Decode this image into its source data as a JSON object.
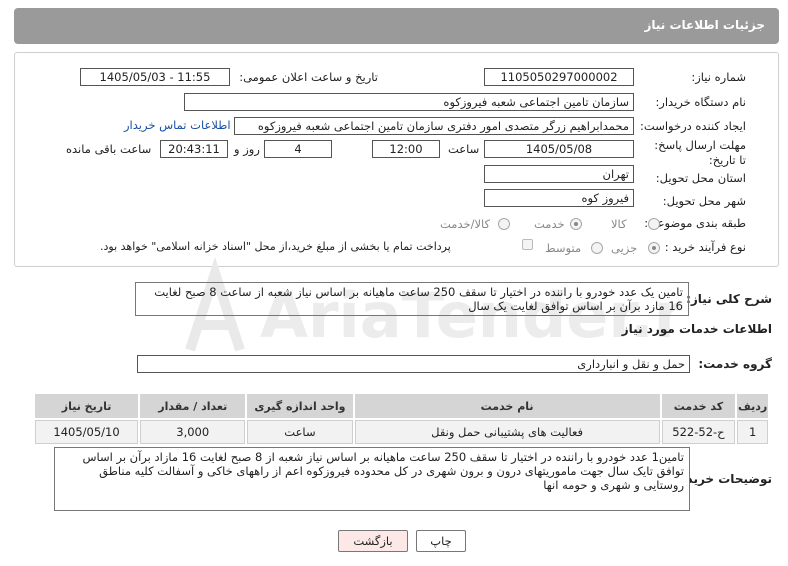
{
  "header": {
    "title": "جزئیات اطلاعات نیاز"
  },
  "form": {
    "need_number_label": "شماره نیاز:",
    "need_number": "1105050297000002",
    "announce_label": "تاریخ و ساعت اعلان عمومی:",
    "announce_value": "1405/05/03 - 11:55",
    "buyer_org_label": "نام دستگاه خریدار:",
    "buyer_org": "سازمان تامین اجتماعی شعبه فیروزکوه",
    "creator_label": "ایجاد کننده درخواست:",
    "creator": "محمدابراهیم زرگر متصدی امور دفتری سازمان تامین اجتماعی شعبه فیروزکوه",
    "contact_link": "اطلاعات تماس خریدار",
    "deadline_label": "مهلت ارسال پاسخ: تا تاریخ:",
    "deadline_date": "1405/05/08",
    "time_label": "ساعت",
    "deadline_time": "12:00",
    "days_value": "4",
    "days_label": "روز و",
    "remaining_time": "20:43:11",
    "remaining_label": "ساعت باقی مانده",
    "province_label": "استان محل تحویل:",
    "province": "تهران",
    "city_label": "شهر محل تحویل:",
    "city": "فیروز کوه",
    "category_label": "طبقه بندی موضوعی:",
    "category_options": [
      "کالا",
      "خدمت",
      "کالا/خدمت"
    ],
    "category_selected": "خدمت",
    "process_label": "نوع فرآیند خرید :",
    "process_options": [
      "جزیی",
      "متوسط"
    ],
    "process_note": "پرداخت تمام یا بخشی از مبلغ خرید،از محل \"اسناد خزانه اسلامی\" خواهد بود."
  },
  "description": {
    "label": "شرح کلی نیاز:",
    "text": "تامین یک عدد خودرو با راننده در اختیار تا سقف 250 ساعت ماهیانه بر اساس نیاز شعبه از ساعت 8 صبح لغایت 16 مازد برآن بر اساس توافق لغایت یک سال"
  },
  "services": {
    "section_title": "اطلاعات خدمات مورد نیاز",
    "group_label": "گروه خدمت:",
    "group_value": "حمل و نقل و انبارداری",
    "columns": [
      "ردیف",
      "کد خدمت",
      "نام خدمت",
      "واحد اندازه گیری",
      "تعداد / مقدار",
      "تاریخ نیاز"
    ],
    "rows": [
      [
        "1",
        "ح-52-522",
        "فعالیت های پشتیبانی حمل ونقل",
        "ساعت",
        "3,000",
        "1405/05/10"
      ]
    ]
  },
  "buyer_notes": {
    "label": "توضیحات خریدار:",
    "text": "تامین1 عدد خودرو با راننده در اختیار تا سقف 250 ساعت ماهیانه بر اساس نیاز شعبه از 8 صبح لغایت 16 مازاد برآن بر اساس توافق تایک سال جهت ماموریتهای درون و برون شهری در کل محدوده فیروزکوه اعم از راههای خاکی و آسفالت کلیه مناطق روستایی و شهری و حومه انها"
  },
  "buttons": {
    "print": "چاپ",
    "back": "بازگشت"
  },
  "watermark": {
    "text": "AriaTender.neT"
  },
  "colors": {
    "header_bg": "#9a9a9a",
    "link": "#1a4fa3",
    "back_btn_bg": "#fde8e8"
  }
}
